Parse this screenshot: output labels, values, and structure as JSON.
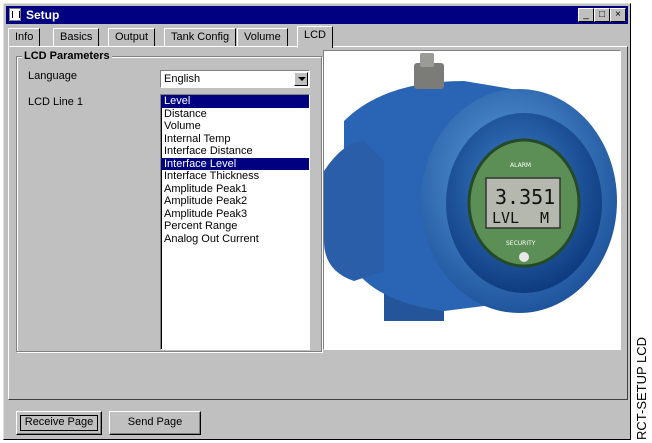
{
  "window": {
    "title": "Setup"
  },
  "tabs": [
    "Info",
    "Basics",
    "Output",
    "Tank Config",
    "Volume",
    "LCD"
  ],
  "active_tab": "LCD",
  "group": {
    "title": "LCD Parameters",
    "language_label": "Language",
    "language_value": "English",
    "line1_label": "LCD Line 1",
    "line1_options": [
      "Level",
      "Distance",
      "Volume",
      "Internal Temp",
      "Interface Distance",
      "Interface Level",
      "Interface Thickness",
      "Amplitude Peak1",
      "Amplitude Peak2",
      "Amplitude Peak3",
      "Percent Range",
      "Analog Out Current"
    ],
    "selected_items": [
      "Level",
      "Interface Level"
    ]
  },
  "display": {
    "value": "3.351",
    "unit_text": "LVL",
    "unit_suffix": "M",
    "alarm": "ALARM",
    "security": "SECURITY"
  },
  "buttons": {
    "receive": "Receive Page",
    "send": "Send Page"
  },
  "side_label": "RCT-SETUP LCD",
  "colors": {
    "selection": "#000080",
    "housing": "#2f6fc0",
    "display": "#b4b8ae"
  }
}
